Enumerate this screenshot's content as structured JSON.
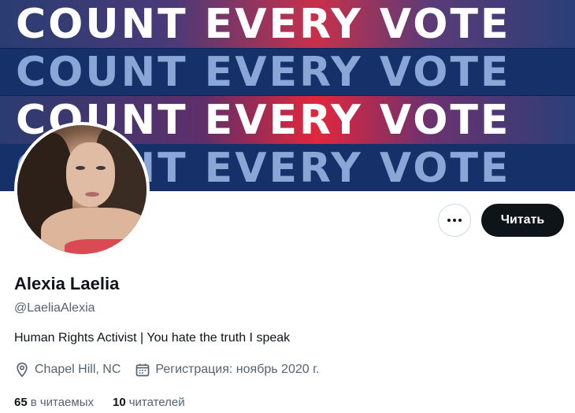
{
  "banner": {
    "rows": [
      "COUNT EVERY VOTE",
      "COUNT EVERY VOTE",
      "COUNT EVERY VOTE",
      "COUNT EVERY VOTE"
    ]
  },
  "actions": {
    "more_icon": "more-horizontal-icon",
    "follow_label": "Читать"
  },
  "profile": {
    "name": "Alexia Laelia",
    "handle": "@LaeliaAlexia",
    "bio": "Human Rights Activist | You hate the truth I speak",
    "location": "Chapel Hill, NC",
    "location_icon": "location-pin-icon",
    "joined": "Регистрация: ноябрь 2020 г.",
    "joined_icon": "calendar-icon"
  },
  "stats": {
    "following_count": "65",
    "following_label": "в читаемых",
    "followers_count": "10",
    "followers_label": "читателей"
  },
  "colors": {
    "text_primary": "#0f1419",
    "text_secondary": "#536471",
    "button_dark": "#0f1419",
    "banner_blue": "#16306a",
    "banner_red": "#e3263c"
  }
}
